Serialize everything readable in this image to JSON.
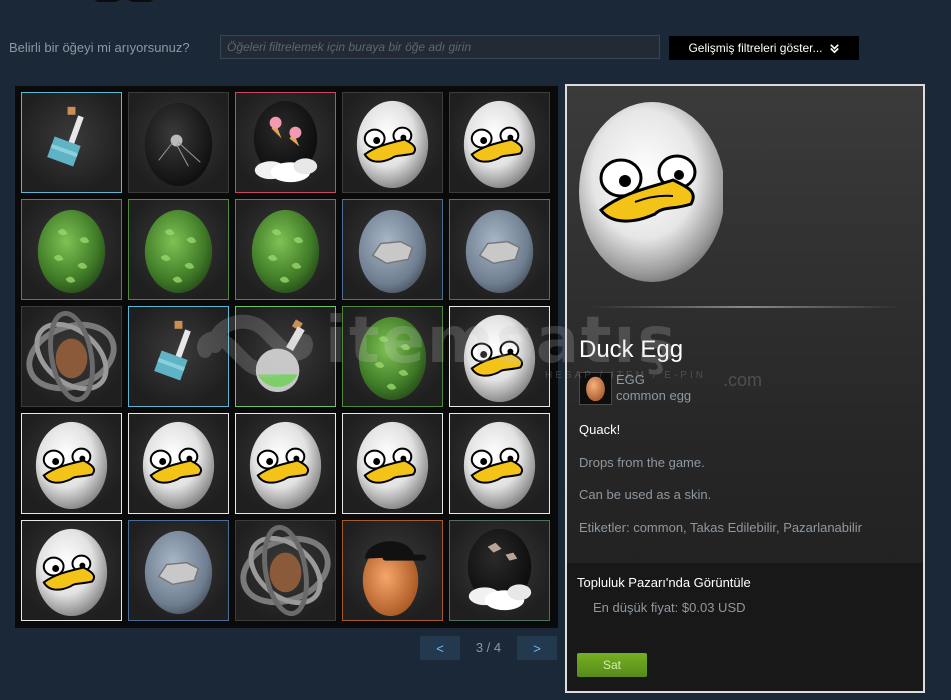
{
  "filter": {
    "label": "Belirli bir öğeyi mi arıyorsunuz?",
    "placeholder": "Öğeleri filtrelemek için buraya bir öğe adı girin",
    "advanced_label": "Gelişmiş filtreleri göster..."
  },
  "inventory": {
    "items": [
      {
        "icon": "bottle-icon",
        "border": "#5fb6d2"
      },
      {
        "icon": "satellite-egg-icon",
        "border": "#3c3c3c"
      },
      {
        "icon": "ice-cream-cloud-egg-icon",
        "border": "#c84a62"
      },
      {
        "icon": "duck-egg-icon",
        "border": "#3c3c3c"
      },
      {
        "icon": "duck-egg-icon",
        "border": "#3c3c3c"
      },
      {
        "icon": "leaf-egg-icon",
        "border": "#4f8a3c"
      },
      {
        "icon": "leaf-egg-icon",
        "border": "#4f8a3c"
      },
      {
        "icon": "leaf-egg-icon",
        "border": "#4f8a3c"
      },
      {
        "icon": "stone-egg-icon",
        "border": "#4d6d95"
      },
      {
        "icon": "stone-egg-icon",
        "border": "#4d6d95"
      },
      {
        "icon": "gyro-egg-icon",
        "border": "#3c3c3c"
      },
      {
        "icon": "bottle-icon",
        "border": "#5fb6d2"
      },
      {
        "icon": "potion-flask-icon",
        "border": "#6ec26a"
      },
      {
        "icon": "leaf-egg-icon",
        "border": "#4f8a3c"
      },
      {
        "icon": "duck-egg-icon",
        "border": "#e8e8e8"
      },
      {
        "icon": "duck-egg-icon",
        "border": "#e8e8e8"
      },
      {
        "icon": "duck-egg-icon",
        "border": "#e8e8e8"
      },
      {
        "icon": "duck-egg-icon",
        "border": "#e8e8e8"
      },
      {
        "icon": "duck-egg-icon",
        "border": "#e8e8e8"
      },
      {
        "icon": "duck-egg-icon",
        "border": "#e8e8e8"
      },
      {
        "icon": "duck-egg-icon",
        "border": "#e8e8e8"
      },
      {
        "icon": "stone-egg-icon",
        "border": "#4d6d95"
      },
      {
        "icon": "gyro-egg-icon",
        "border": "#3c3c3c"
      },
      {
        "icon": "cap-egg-icon",
        "border": "#a65a2a"
      },
      {
        "icon": "cloud-rocks-egg-icon",
        "border": "#4f6f5f"
      }
    ]
  },
  "pager": {
    "prev_label": "<",
    "next_label": ">",
    "page_text": "3 / 4"
  },
  "detail": {
    "name": "Duck Egg",
    "game_name": "EGG",
    "item_type": "common egg",
    "description_lines": [
      "Quack!",
      "Drops from the game.",
      "Can be used as a skin."
    ],
    "tags_label": "Etiketler:",
    "tags": "common, Takas Edilebilir, Pazarlanabilir",
    "market_title": "Topluluk Pazarı'nda Görüntüle",
    "price_label": "En düşük fiyat:",
    "price_value": "$0.03 USD",
    "sell_label": "Sat"
  },
  "watermark": {
    "text": "itemsatış",
    "sub": "HESAP / ITEM / E-PIN",
    "domain": ".com"
  },
  "colors": {
    "background": "#1b2838",
    "accent_link": "#67c1f5",
    "sell_green": "#75b022"
  }
}
